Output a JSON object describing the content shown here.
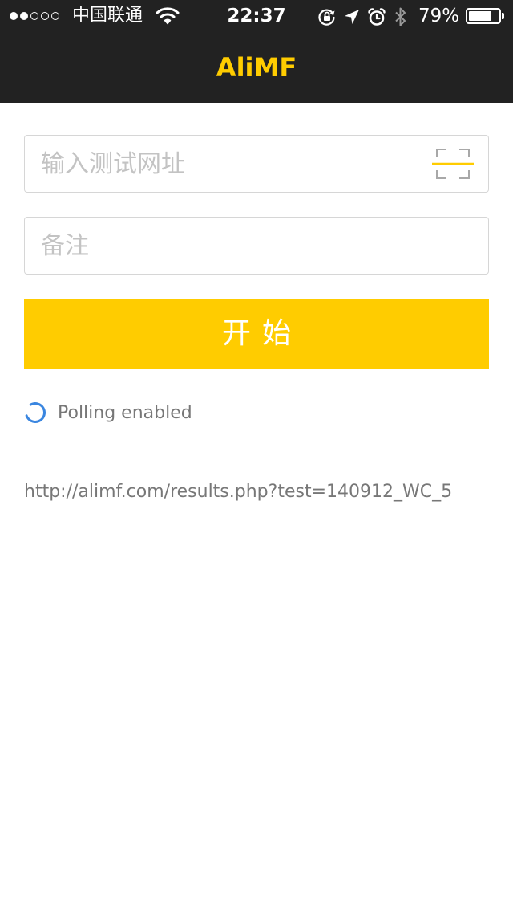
{
  "status_bar": {
    "signal_strength_bars": 2,
    "signal_total_bars": 5,
    "carrier": "中国联通",
    "time": "22:37",
    "battery_percent_label": "79%",
    "battery_level": 0.79,
    "icons": [
      "wifi-icon",
      "rotation-lock-icon",
      "location-arrow-icon",
      "alarm-clock-icon",
      "bluetooth-icon",
      "battery-icon"
    ]
  },
  "nav": {
    "title": "AliMF"
  },
  "form": {
    "url_placeholder": "输入测试网址",
    "url_value": "",
    "scan_icon": "qr-scan-icon",
    "note_placeholder": "备注",
    "note_value": "",
    "start_label": "开始"
  },
  "status": {
    "polling_label": "Polling enabled",
    "spinner_icon": "loading-spinner-icon"
  },
  "result": {
    "url": "http://alimf.com/results.php?test=140912_WC_5"
  },
  "colors": {
    "bar_background": "#222222",
    "accent": "#ffcc00",
    "field_border": "#d6d6d6",
    "placeholder": "#c3c3c3",
    "secondary_text": "#777777",
    "spinner": "#3a86e0"
  }
}
